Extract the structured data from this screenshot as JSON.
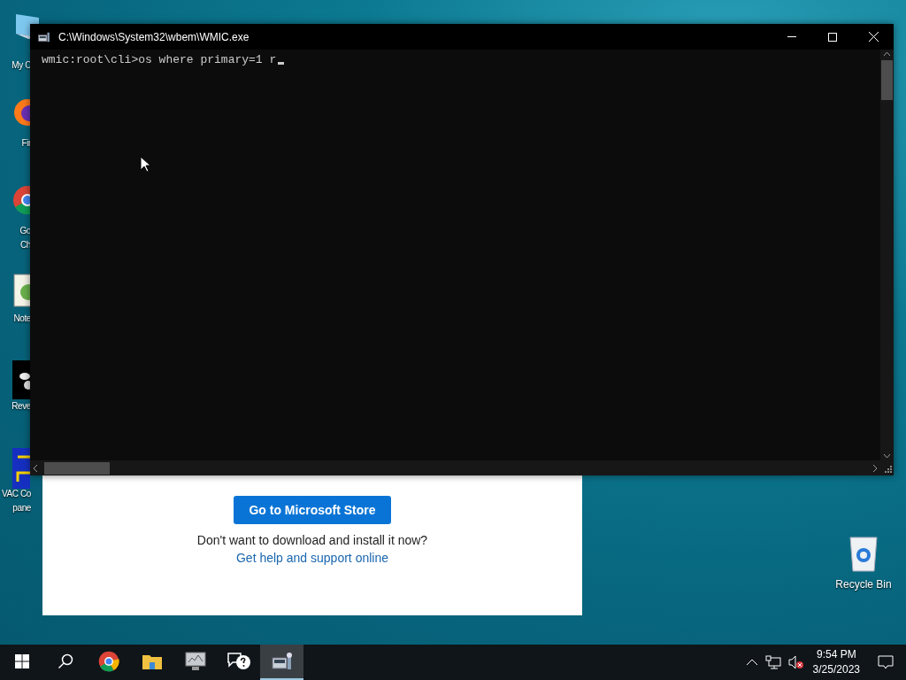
{
  "desktop_icons": [
    {
      "kind": "computer",
      "label": "My C"
    },
    {
      "kind": "firefox",
      "label": "Fir"
    },
    {
      "kind": "chrome",
      "label": "Go\nCh"
    },
    {
      "kind": "notepad",
      "label": "Note"
    },
    {
      "kind": "dark-app",
      "label": "Reve"
    },
    {
      "kind": "cables",
      "label": "VAC Co\npane"
    }
  ],
  "recycle_bin": {
    "label": "Recycle Bin"
  },
  "store_dialog": {
    "button": "Go to Microsoft Store",
    "message": "Don't want to download and install it now?",
    "link": "Get help and support online"
  },
  "console_window": {
    "title": "C:\\Windows\\System32\\wbem\\WMIC.exe",
    "lines": [
      "wmic:root\\cli>os where primary=1 r"
    ]
  },
  "taskbar": {
    "items": [
      {
        "kind": "start",
        "selected": false
      },
      {
        "kind": "search",
        "selected": false
      },
      {
        "kind": "chrome",
        "selected": false
      },
      {
        "kind": "folder",
        "selected": false
      },
      {
        "kind": "monitor",
        "selected": false
      },
      {
        "kind": "help",
        "selected": false
      },
      {
        "kind": "wmic",
        "selected": true
      }
    ],
    "tray": {
      "time": "9:54 PM",
      "date": "3/25/2023"
    }
  }
}
